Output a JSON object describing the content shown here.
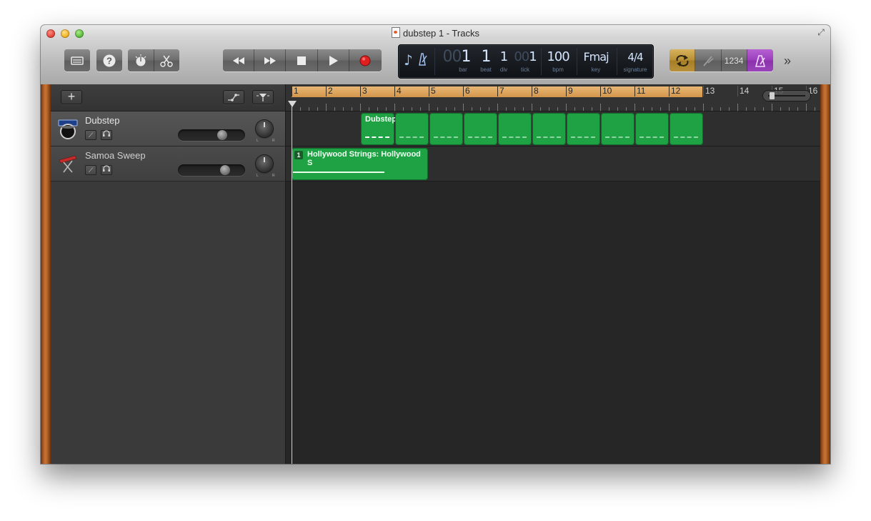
{
  "window": {
    "title": "dubstep 1 - Tracks"
  },
  "toolbar": {
    "left_buttons": [
      {
        "name": "library-button",
        "icon": "library-icon"
      },
      {
        "name": "quick-help-button",
        "icon": "help-icon",
        "glyph": "?"
      },
      {
        "name": "smart-controls-button",
        "icon": "knob-icon"
      },
      {
        "name": "editors-button",
        "icon": "scissors-icon"
      }
    ],
    "transport": [
      {
        "name": "rewind-button",
        "glyph": "◀◀"
      },
      {
        "name": "fast-forward-button",
        "glyph": "▶▶"
      },
      {
        "name": "stop-button",
        "glyph": "■"
      },
      {
        "name": "play-button",
        "glyph": "▶"
      },
      {
        "name": "record-button",
        "glyph": "●"
      }
    ],
    "lcd": {
      "bar_dim": "00",
      "bar": "1",
      "bar_label": "bar",
      "beat": "1",
      "beat_label": "beat",
      "div": "1",
      "div_label": "div",
      "tick_dim": "00",
      "tick": "1",
      "tick_label": "tick",
      "bpm": "100",
      "bpm_label": "bpm",
      "key": "Fmaj",
      "key_label": "key",
      "signature": "4/4",
      "signature_label": "signature"
    },
    "count_in_label": "1234",
    "more_glyph": "»"
  },
  "tracks": [
    {
      "name": "Dubstep",
      "icon": "drum-kit-icon",
      "volume": 0.7,
      "selected": true
    },
    {
      "name": "Samoa Sweep",
      "icon": "keyboard-icon",
      "volume": 0.75,
      "selected": false
    }
  ],
  "headers_toolbar": {
    "add_label": "+"
  },
  "ruler": {
    "bars": [
      "1",
      "2",
      "3",
      "4",
      "5",
      "6",
      "7",
      "8",
      "9",
      "10",
      "11",
      "12",
      "13",
      "14",
      "15",
      "16"
    ],
    "cycle_end_bar": 13
  },
  "regions": {
    "dubstep_title": "Dubstep",
    "dubstep_start_bar": 3,
    "dubstep_end_bar": 13,
    "strings_title": "Hollywood Strings: Hollywood S",
    "strings_loop_badge": "1",
    "strings_start_bar": 1,
    "strings_end_bar": 5
  },
  "colors": {
    "region_green": "#1fa243",
    "cycle_orange": "#d2954a",
    "record_red": "#e02020",
    "cycle_button_yellow": "#c9a34a",
    "metronome_purple": "#9b3dbd"
  }
}
